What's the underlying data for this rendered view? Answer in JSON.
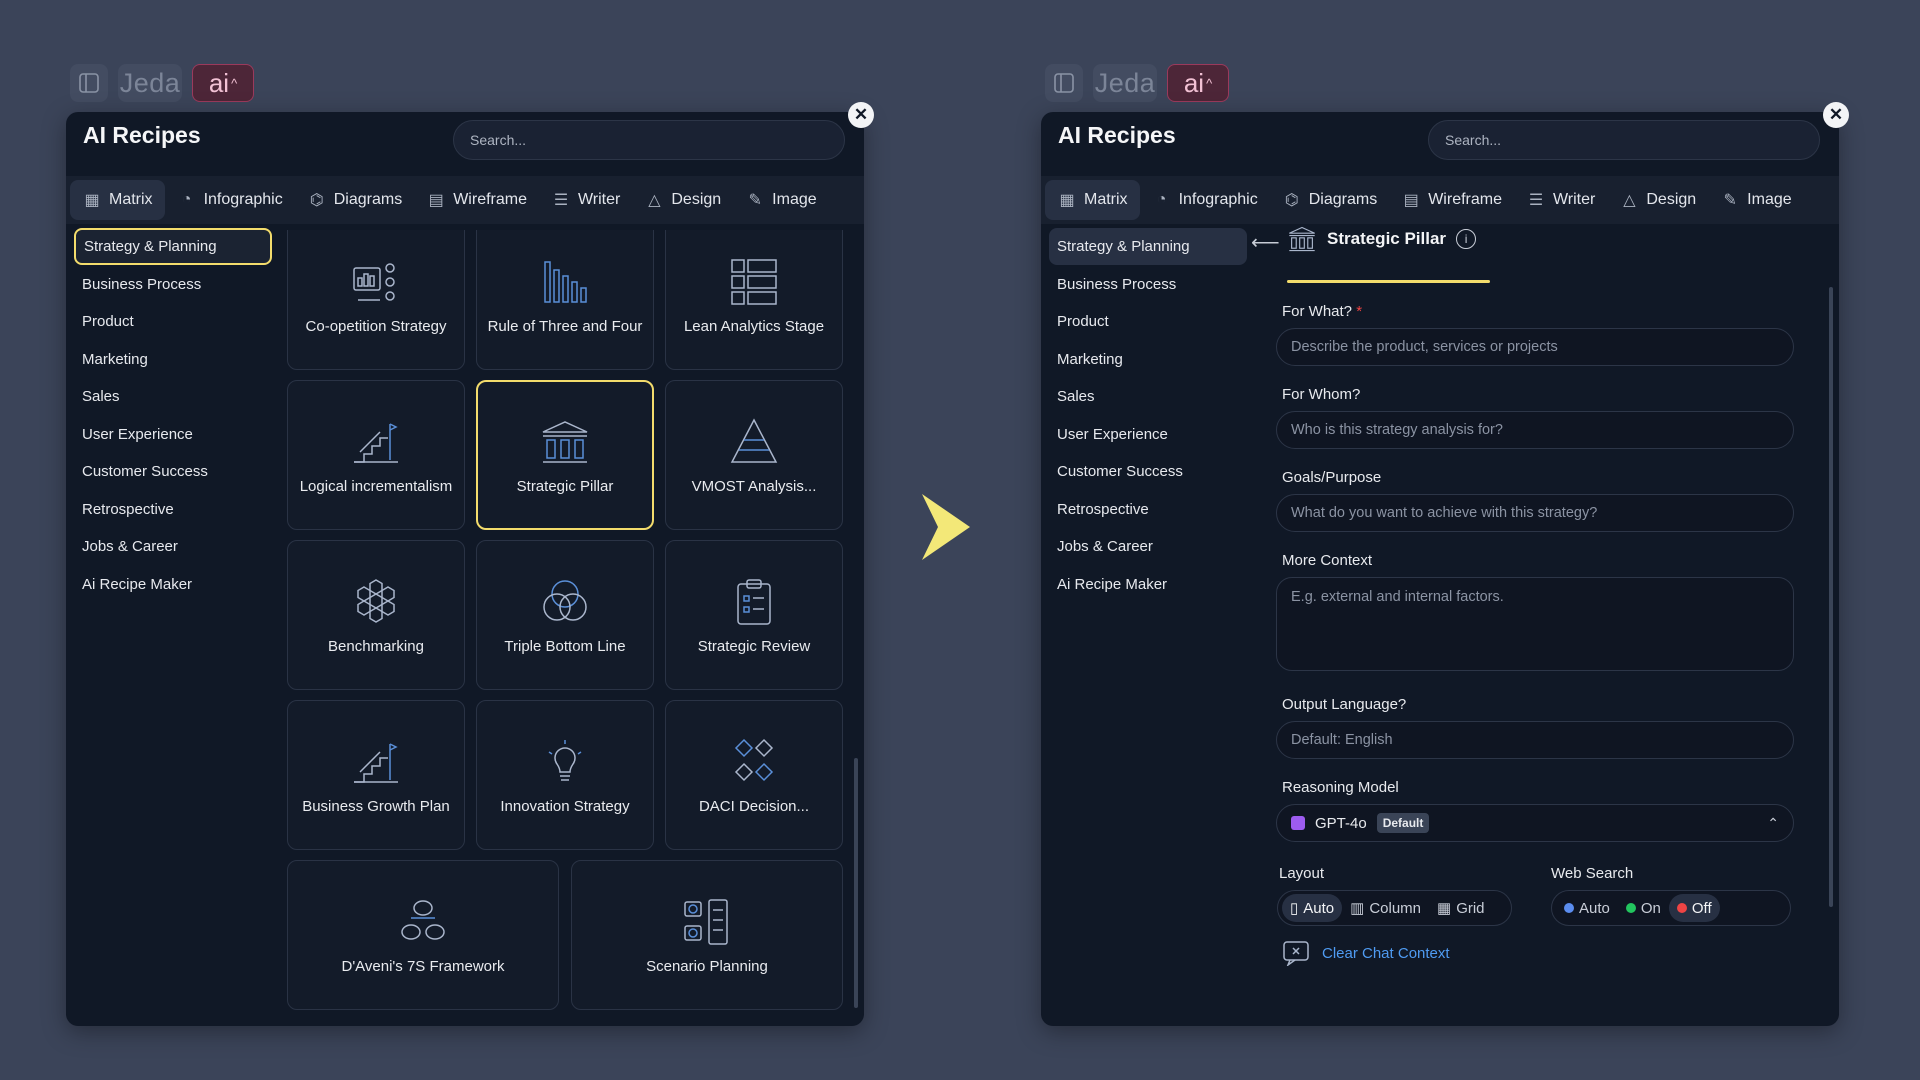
{
  "colors": {
    "background": "#3b4459",
    "panel": "#101826",
    "highlight": "#f3dc6c",
    "link": "#4f9bf2",
    "ai_accent": "#9b3a5c"
  },
  "topbar": {
    "brand": "Jeda",
    "ai_label": "ai"
  },
  "left": {
    "title": "AI Recipes",
    "search_placeholder": "Search...",
    "tabs": [
      {
        "label": "Matrix",
        "icon": "grid-icon"
      },
      {
        "label": "Infographic",
        "icon": "pie-chart-icon"
      },
      {
        "label": "Diagrams",
        "icon": "diagram-icon"
      },
      {
        "label": "Wireframe",
        "icon": "wireframe-icon"
      },
      {
        "label": "Writer",
        "icon": "writer-icon"
      },
      {
        "label": "Design",
        "icon": "shapes-icon"
      },
      {
        "label": "Image",
        "icon": "brush-icon"
      }
    ],
    "categories": [
      "Strategy & Planning",
      "Business Process",
      "Product",
      "Marketing",
      "Sales",
      "User Experience",
      "Customer Success",
      "Retrospective",
      "Jobs & Career",
      "Ai Recipe Maker"
    ],
    "recipes": [
      {
        "label": "Co-opetition Strategy",
        "icon": "coopetition-icon"
      },
      {
        "label": "Rule of Three and Four",
        "icon": "bars-icon"
      },
      {
        "label": "Lean Analytics Stage",
        "icon": "stages-icon"
      },
      {
        "label": "Logical incrementalism",
        "icon": "stairs-icon"
      },
      {
        "label": "Strategic Pillar",
        "icon": "pillar-icon"
      },
      {
        "label": "VMOST Analysis...",
        "icon": "pyramid-icon"
      },
      {
        "label": "Benchmarking",
        "icon": "hexagons-icon"
      },
      {
        "label": "Triple Bottom Line",
        "icon": "venn-icon"
      },
      {
        "label": "Strategic Review",
        "icon": "clipboard-icon"
      },
      {
        "label": "Business Growth Plan",
        "icon": "growth-icon"
      },
      {
        "label": "Innovation Strategy",
        "icon": "lightbulb-icon"
      },
      {
        "label": "DACI Decision...",
        "icon": "diamonds-icon"
      },
      {
        "label": "D'Aveni's 7S Framework",
        "icon": "circles-icon"
      },
      {
        "label": "Scenario Planning",
        "icon": "scenario-icon"
      }
    ]
  },
  "right": {
    "title": "AI Recipes",
    "search_placeholder": "Search...",
    "recipe_title": "Strategic Pillar",
    "info_glyph": "i",
    "fields": [
      {
        "label": "For What?",
        "required": "*",
        "placeholder": "Describe the product, services or projects"
      },
      {
        "label": "For Whom?",
        "placeholder": "Who is this strategy analysis for?"
      },
      {
        "label": "Goals/Purpose",
        "placeholder": "What do you want to achieve with this strategy?"
      },
      {
        "label": "More Context",
        "placeholder": "E.g. external and internal factors."
      },
      {
        "label": "Output Language?",
        "placeholder": "Default: English"
      }
    ],
    "reasoning": {
      "label": "Reasoning Model",
      "model": "GPT-4o",
      "badge": "Default"
    },
    "layout": {
      "label": "Layout",
      "options": [
        "Auto",
        "Column",
        "Grid"
      ],
      "selected": "Auto"
    },
    "web_search": {
      "label": "Web Search",
      "options": [
        {
          "label": "Auto",
          "color": "#5b8def"
        },
        {
          "label": "On",
          "color": "#22c55e"
        },
        {
          "label": "Off",
          "color": "#ef4444"
        }
      ],
      "selected": "Off"
    },
    "clear_label": "Clear Chat Context"
  }
}
